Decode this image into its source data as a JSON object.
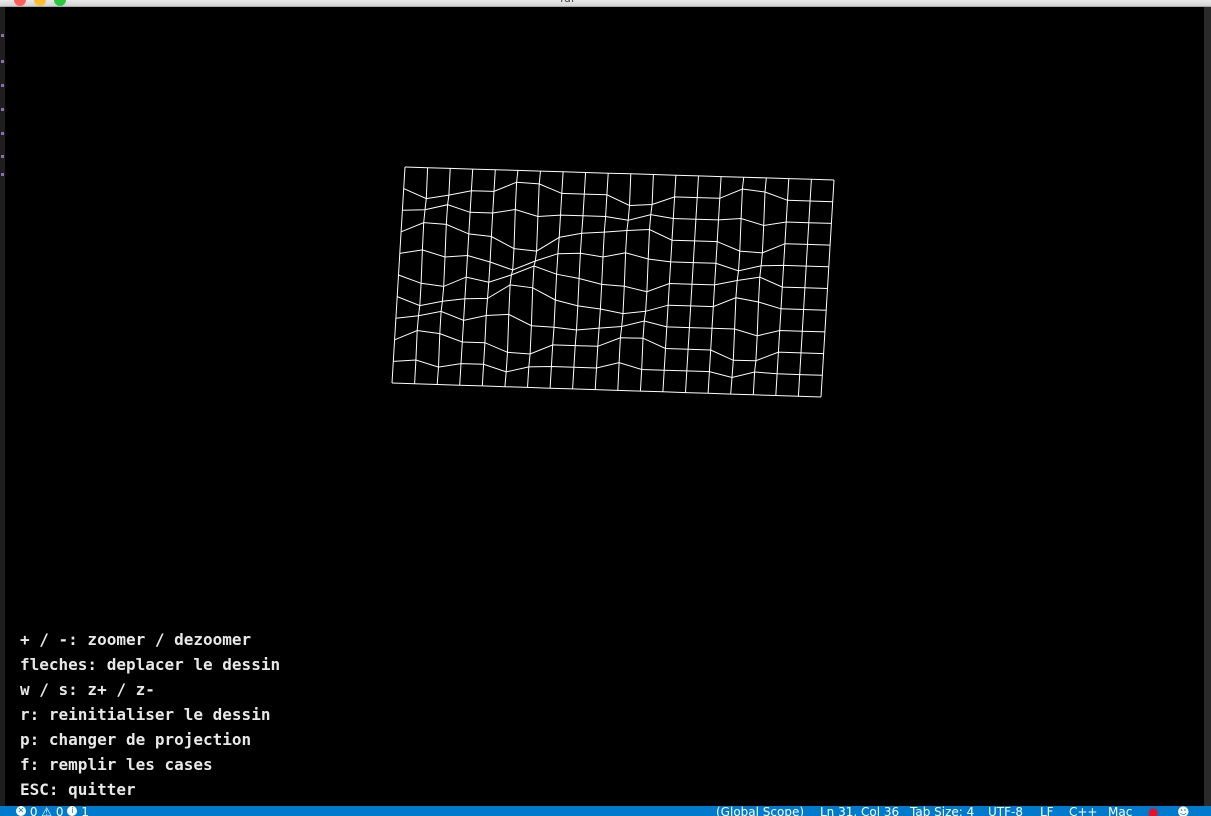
{
  "window": {
    "title": "fdf"
  },
  "help_lines": [
    "+ / -: zoomer / dezoomer",
    "fleches: deplacer le dessin",
    "w / s: z+ / z-",
    "r: reinitialiser le dessin",
    "p: changer de projection",
    "f: remplir les cases",
    "ESC: quitter"
  ],
  "mesh": {
    "color": "#ffffff",
    "background": "#000000",
    "columns": 19,
    "rows": 10
  },
  "statusbar": {
    "errors": "0",
    "warnings": "0",
    "info": "1",
    "scope": "(Global Scope)",
    "position": "Ln 31, Col 36",
    "tab_size": "Tab Size: 4",
    "encoding": "UTF-8",
    "eol": "LF",
    "language": "C++",
    "platform": "Mac"
  }
}
